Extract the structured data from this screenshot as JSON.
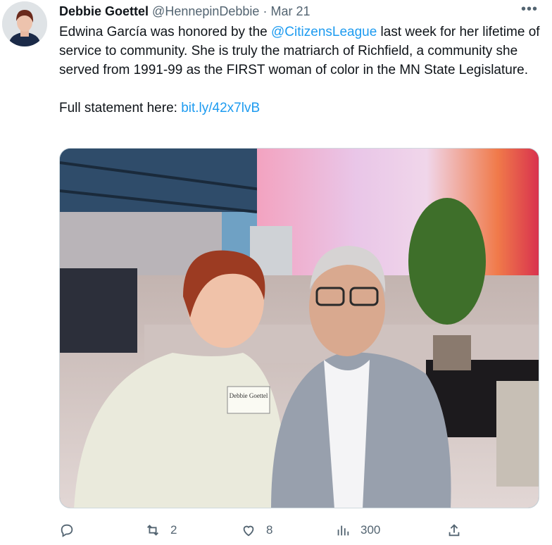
{
  "tweet": {
    "author_name": "Debbie Goettel",
    "handle": "@HennepinDebbie",
    "separator": "·",
    "date": "Mar 21",
    "text_parts": {
      "intro": "Edwina García was honored by the ",
      "mention": "@CitizensLeague",
      "rest": " last week for her lifetime of service to community. She is truly the matriarch of Richfield, a community she served from 1991-99 as the FIRST woman of color in the MN State Legislature.",
      "statement_label": "Full statement here: ",
      "statement_link": "bit.ly/42x7lvB"
    },
    "name_tag_text": "Debbie Goettel",
    "more_icon": "more-horizontal-icon",
    "actions": {
      "reply_count": "",
      "retweet_count": "2",
      "like_count": "8",
      "views_count": "300",
      "share_count": ""
    }
  },
  "colors": {
    "link": "#1d9bf0",
    "muted": "#536471",
    "text": "#0f1419"
  }
}
